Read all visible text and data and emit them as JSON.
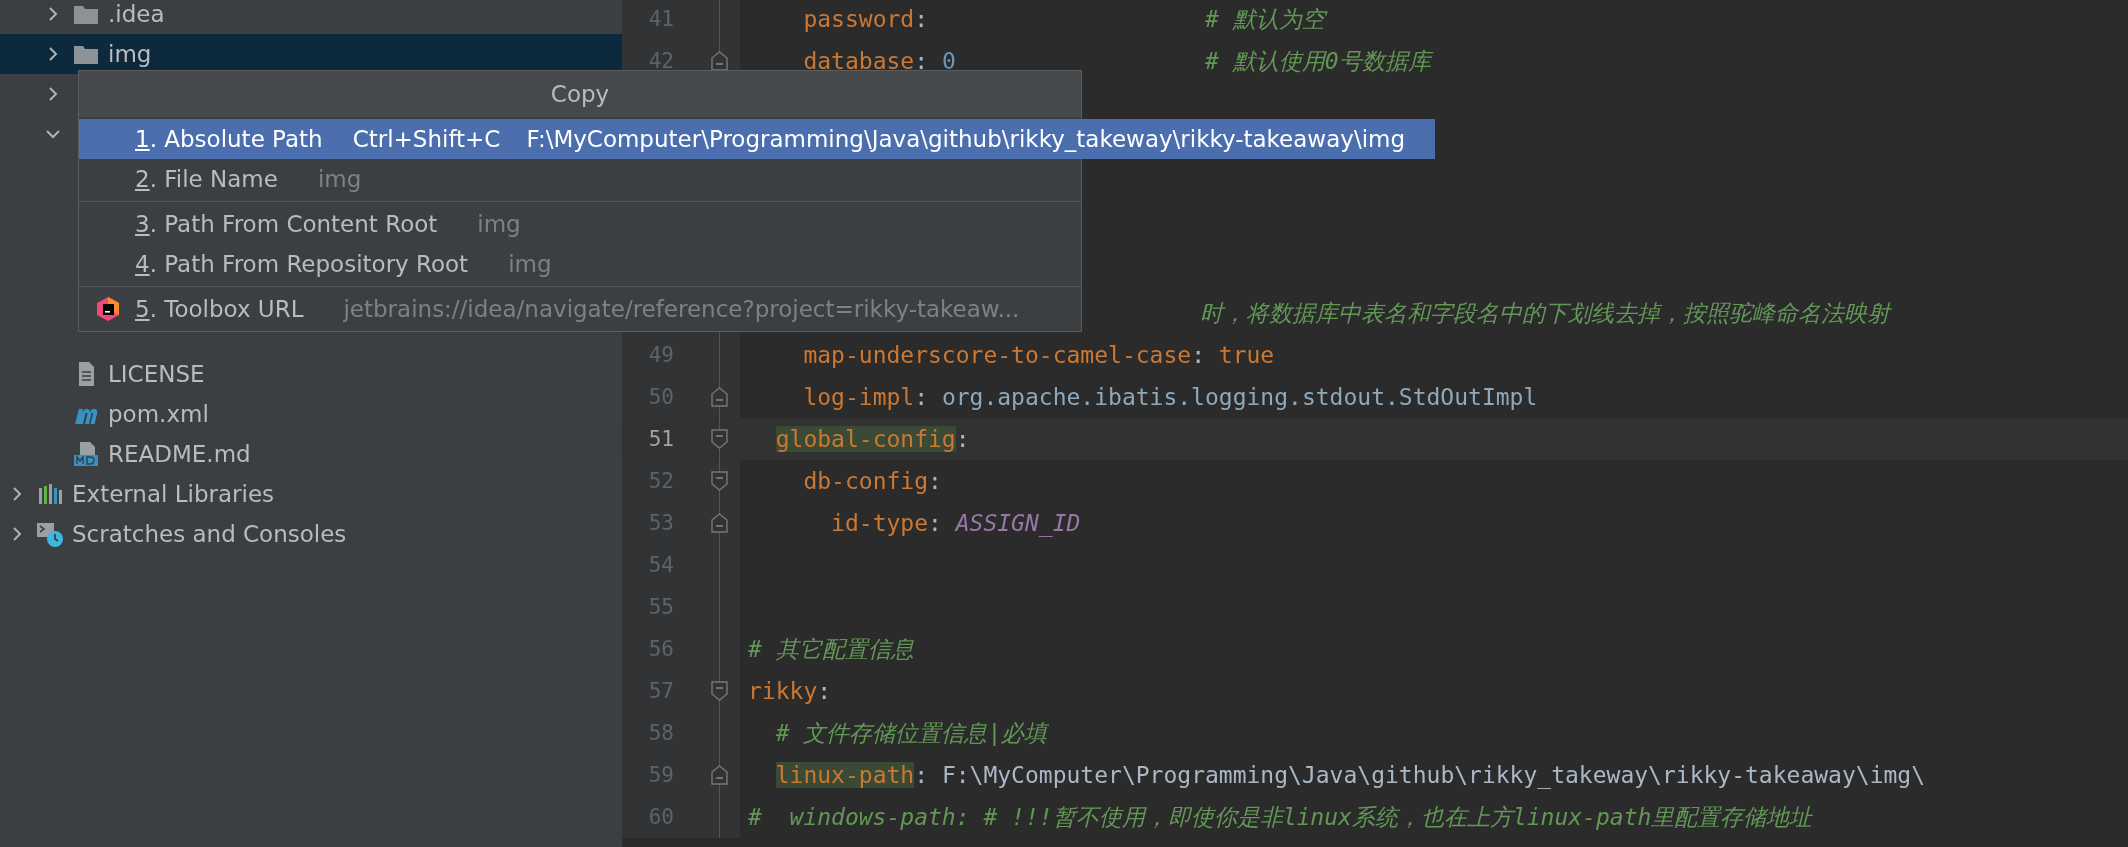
{
  "project_tree": {
    "items": [
      {
        "kind": "folder",
        "label": ".idea",
        "expanded": false,
        "selected": false
      },
      {
        "kind": "folder",
        "label": "img",
        "expanded": false,
        "selected": true
      },
      {
        "expanded": false,
        "selected": false
      },
      {
        "expanded": true,
        "selected": false
      },
      {
        "kind": "text",
        "label": "LICENSE",
        "selected": false
      },
      {
        "kind": "maven",
        "label": "pom.xml",
        "selected": false
      },
      {
        "kind": "markdown",
        "label": "README.md",
        "selected": false
      }
    ],
    "top_level": [
      {
        "kind": "libraries",
        "label": "External Libraries",
        "expanded": false
      },
      {
        "kind": "scratches",
        "label": "Scratches and Consoles",
        "expanded": false
      }
    ]
  },
  "editor": {
    "lines": [
      {
        "kind": "line",
        "number": "41",
        "current": false,
        "tokens": [
          {
            "kind": "key",
            "text": "    password"
          },
          {
            "kind": "plain",
            "text": ":                    "
          },
          {
            "kind": "comment",
            "text": "# 默认为空"
          }
        ]
      },
      {
        "kind": "line",
        "number": "42",
        "current": false,
        "fold": {
          "kind": "end"
        },
        "tokens": [
          {
            "kind": "key",
            "text": "    database"
          },
          {
            "kind": "plain",
            "text": ": "
          },
          {
            "kind": "number",
            "text": "0                  "
          },
          {
            "kind": "comment",
            "text": "# 默认使用0号数据库"
          }
        ]
      },
      {
        "kind": "covered"
      },
      {
        "kind": "covered"
      },
      {
        "kind": "covered"
      },
      {
        "kind": "covered"
      },
      {
        "kind": "covered"
      },
      {
        "kind": "partial",
        "tokens": [
          {
            "kind": "comment",
            "text": "时，将数据库中表名和字段名中的下划线去掉，按照驼峰命名法映射"
          }
        ]
      },
      {
        "kind": "line",
        "number": "49",
        "current": false,
        "tokens": [
          {
            "kind": "key",
            "text": "    map-underscore-to-camel-case"
          },
          {
            "kind": "plain",
            "text": ": "
          },
          {
            "kind": "bool",
            "text": "true"
          }
        ]
      },
      {
        "kind": "line",
        "number": "50",
        "current": false,
        "fold": {
          "kind": "end"
        },
        "tokens": [
          {
            "kind": "key",
            "text": "    log-impl"
          },
          {
            "kind": "plain",
            "text": ": "
          },
          {
            "kind": "class",
            "text": "org.apache.ibatis.logging.stdout.StdOutImpl"
          }
        ]
      },
      {
        "kind": "line",
        "number": "51",
        "current": true,
        "fold": {
          "kind": "start"
        },
        "tokens": [
          {
            "kind": "key_marked",
            "text": "  global-config"
          },
          {
            "kind": "plain",
            "text": ":"
          }
        ]
      },
      {
        "kind": "line",
        "number": "52",
        "current": false,
        "fold": {
          "kind": "start"
        },
        "tokens": [
          {
            "kind": "key",
            "text": "    db-config"
          },
          {
            "kind": "plain",
            "text": ":"
          }
        ]
      },
      {
        "kind": "line",
        "number": "53",
        "current": false,
        "fold": {
          "kind": "end"
        },
        "tokens": [
          {
            "kind": "key",
            "text": "      id-type"
          },
          {
            "kind": "plain",
            "text": ": "
          },
          {
            "kind": "constant",
            "text": "ASSIGN_ID"
          }
        ]
      },
      {
        "kind": "line",
        "number": "54",
        "current": false
      },
      {
        "kind": "line",
        "number": "55",
        "current": false
      },
      {
        "kind": "line",
        "number": "56",
        "current": false,
        "tokens": [
          {
            "kind": "comment",
            "text": "# 其它配置信息"
          }
        ]
      },
      {
        "kind": "line",
        "number": "57",
        "current": false,
        "fold": {
          "kind": "start"
        },
        "tokens": [
          {
            "kind": "key",
            "text": "rikky"
          },
          {
            "kind": "plain",
            "text": ":"
          }
        ]
      },
      {
        "kind": "line",
        "number": "58",
        "current": false,
        "tokens": [
          {
            "kind": "comment",
            "text": "  # 文件存储位置信息|必填"
          }
        ]
      },
      {
        "kind": "line",
        "number": "59",
        "current": false,
        "fold": {
          "kind": "end"
        },
        "tokens": [
          {
            "kind": "key_marked",
            "text": "  linux-path"
          },
          {
            "kind": "plain",
            "text": ": F:\\MyComputer\\Programming\\Java\\github\\rikky_takeway\\rikky-takeaway\\img\\"
          }
        ]
      },
      {
        "kind": "line",
        "number": "60",
        "current": false,
        "tokens": [
          {
            "kind": "comment",
            "text": "#  windows-path: # !!!暂不使用，即使你是非linux系统，也在上方linux-path里配置存储地址"
          }
        ]
      }
    ]
  },
  "copy_popup": {
    "title": "Copy",
    "groups": [
      [
        {
          "kind": "plain",
          "label": "1. Absolute Path",
          "shortcut": "Ctrl+Shift+C",
          "value": "F:\\MyComputer\\Programming\\Java\\github\\rikky_takeway\\rikky-takeaway\\img",
          "selected": true
        },
        {
          "kind": "plain",
          "label": "2. File Name",
          "value": "img",
          "selected": false
        }
      ],
      [
        {
          "kind": "plain",
          "label": "3. Path From Content Root",
          "value": "img",
          "selected": false
        },
        {
          "kind": "plain",
          "label": "4. Path From Repository Root",
          "value": "img",
          "selected": false
        }
      ],
      [
        {
          "kind": "toolbox",
          "label": "5. Toolbox URL",
          "value": "jetbrains://idea/navigate/reference?project=rikky-takeaw...",
          "selected": false
        }
      ]
    ]
  }
}
